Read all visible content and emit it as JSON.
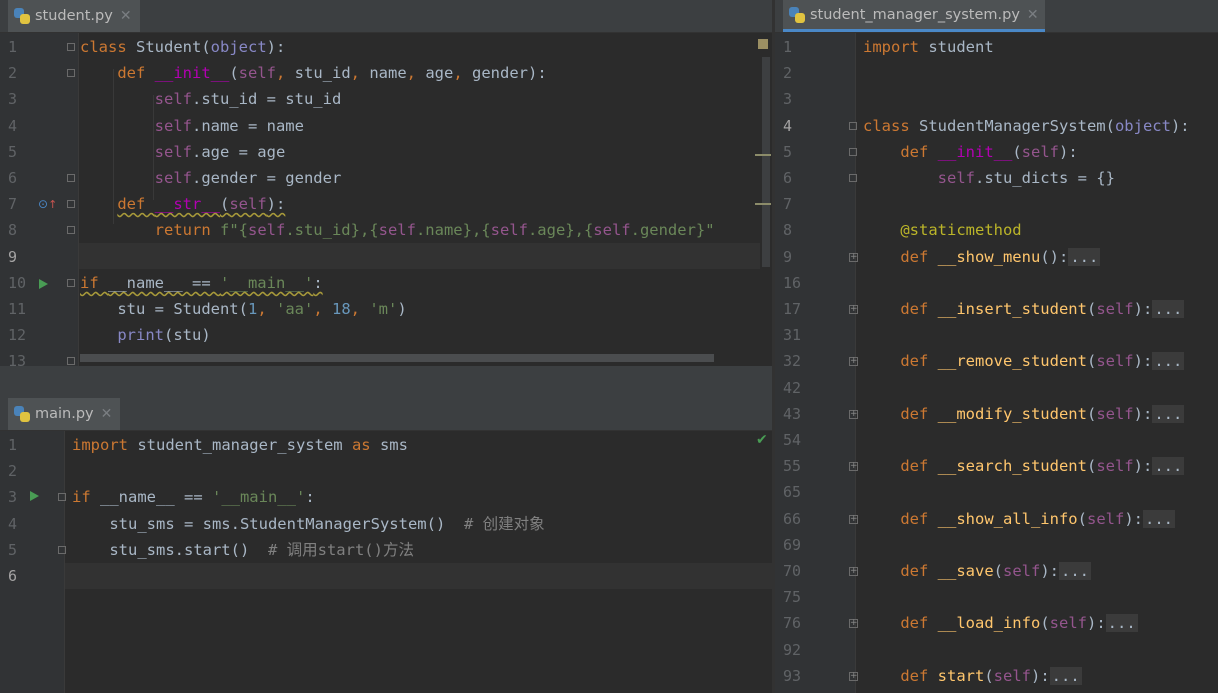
{
  "student": {
    "tab": "student.py",
    "lines": [
      {
        "n": "1",
        "s": [
          [
            "kw",
            "class "
          ],
          [
            "",
            "Student("
          ],
          [
            "ob",
            "object"
          ],
          [
            "",
            "):"
          ]
        ]
      },
      {
        "n": "2",
        "s": [
          [
            "",
            "    "
          ],
          [
            "kw",
            "def "
          ],
          [
            "mg",
            "__init__"
          ],
          [
            "",
            "("
          ],
          [
            "sf",
            "self"
          ],
          [
            "kw",
            ", "
          ],
          [
            "",
            "stu_id"
          ],
          [
            "kw",
            ", "
          ],
          [
            "",
            "name"
          ],
          [
            "kw",
            ", "
          ],
          [
            "",
            "age"
          ],
          [
            "kw",
            ", "
          ],
          [
            "",
            "gender):"
          ]
        ]
      },
      {
        "n": "3",
        "s": [
          [
            "",
            "        "
          ],
          [
            "sf",
            "self"
          ],
          [
            "",
            ".stu_id = stu_id"
          ]
        ]
      },
      {
        "n": "4",
        "s": [
          [
            "",
            "        "
          ],
          [
            "sf",
            "self"
          ],
          [
            "",
            ".name = name"
          ]
        ]
      },
      {
        "n": "5",
        "s": [
          [
            "",
            "        "
          ],
          [
            "sf",
            "self"
          ],
          [
            "",
            ".age = age"
          ]
        ]
      },
      {
        "n": "6",
        "s": [
          [
            "",
            "        "
          ],
          [
            "sf",
            "self"
          ],
          [
            "",
            ".gender = gender"
          ]
        ]
      },
      {
        "n": "7",
        "s": [
          [
            "",
            "    "
          ],
          [
            "kw",
            "def "
          ],
          [
            "mg",
            "__str__"
          ],
          [
            "",
            "("
          ],
          [
            "sf",
            "self"
          ],
          [
            "",
            "):"
          ]
        ]
      },
      {
        "n": "8",
        "s": [
          [
            "",
            "        "
          ],
          [
            "kw",
            "return "
          ],
          [
            "st",
            "f\"{"
          ],
          [
            "sf",
            "self"
          ],
          [
            "st",
            ".stu_id},{"
          ],
          [
            "sf",
            "self"
          ],
          [
            "st",
            ".name},{"
          ],
          [
            "sf",
            "self"
          ],
          [
            "st",
            ".age},{"
          ],
          [
            "sf",
            "self"
          ],
          [
            "st",
            ".gender}\""
          ]
        ]
      },
      {
        "n": "9",
        "s": []
      },
      {
        "n": "10",
        "s": [
          [
            "kw",
            "if "
          ],
          [
            "",
            "__name__ == "
          ],
          [
            "st",
            "'__main__'"
          ],
          [
            "",
            ":"
          ]
        ]
      },
      {
        "n": "11",
        "s": [
          [
            "",
            "    stu = Student("
          ],
          [
            "nm",
            "1"
          ],
          [
            "kw",
            ", "
          ],
          [
            "st",
            "'aa'"
          ],
          [
            "kw",
            ", "
          ],
          [
            "nm",
            "18"
          ],
          [
            "kw",
            ", "
          ],
          [
            "st",
            "'m'"
          ],
          [
            "",
            ")"
          ]
        ]
      },
      {
        "n": "12",
        "s": [
          [
            "",
            "    "
          ],
          [
            "ob",
            "print"
          ],
          [
            "",
            "(stu)"
          ]
        ]
      },
      {
        "n": "13",
        "s": []
      }
    ]
  },
  "main": {
    "tab": "main.py",
    "lines": [
      {
        "n": "1",
        "s": [
          [
            "kw",
            "import "
          ],
          [
            "",
            "student_manager_system "
          ],
          [
            "kw",
            "as "
          ],
          [
            "",
            "sms"
          ]
        ]
      },
      {
        "n": "2",
        "s": []
      },
      {
        "n": "3",
        "s": [
          [
            "kw",
            "if "
          ],
          [
            "",
            "__name__ == "
          ],
          [
            "st",
            "'__main__'"
          ],
          [
            "",
            ":"
          ]
        ]
      },
      {
        "n": "4",
        "s": [
          [
            "",
            "    stu_sms = sms.StudentManagerSystem()  "
          ],
          [
            "cm",
            "# 创建对象"
          ]
        ]
      },
      {
        "n": "5",
        "s": [
          [
            "",
            "    stu_sms.start()  "
          ],
          [
            "cm",
            "# 调用start()方法"
          ]
        ]
      },
      {
        "n": "6",
        "s": []
      }
    ]
  },
  "sms": {
    "tab": "student_manager_system.py",
    "lines": [
      {
        "n": "1",
        "s": [
          [
            "kw",
            "import "
          ],
          [
            "",
            "student"
          ]
        ]
      },
      {
        "n": "2",
        "s": []
      },
      {
        "n": "3",
        "s": []
      },
      {
        "n": "4",
        "s": [
          [
            "kw",
            "class "
          ],
          [
            "",
            "StudentManagerSystem("
          ],
          [
            "ob",
            "object"
          ],
          [
            "",
            "):"
          ]
        ]
      },
      {
        "n": "5",
        "s": [
          [
            "",
            "    "
          ],
          [
            "kw",
            "def "
          ],
          [
            "mg",
            "__init__"
          ],
          [
            "",
            "("
          ],
          [
            "sf",
            "self"
          ],
          [
            "",
            "):"
          ]
        ]
      },
      {
        "n": "6",
        "s": [
          [
            "",
            "        "
          ],
          [
            "sf",
            "self"
          ],
          [
            "",
            ".stu_dicts = {}"
          ]
        ]
      },
      {
        "n": "7",
        "s": []
      },
      {
        "n": "8",
        "s": [
          [
            "",
            "    "
          ],
          [
            "dec",
            "@staticmethod"
          ]
        ]
      },
      {
        "n": "9",
        "s": [
          [
            "",
            "    "
          ],
          [
            "kw",
            "def "
          ],
          [
            "fn",
            "__show_menu"
          ],
          [
            "",
            "():"
          ],
          [
            "c",
            "..."
          ]
        ]
      },
      {
        "n": "16",
        "s": []
      },
      {
        "n": "17",
        "s": [
          [
            "",
            "    "
          ],
          [
            "kw",
            "def "
          ],
          [
            "fn",
            "__insert_student"
          ],
          [
            "",
            "("
          ],
          [
            "sf",
            "self"
          ],
          [
            "",
            "):"
          ],
          [
            "c",
            "..."
          ]
        ]
      },
      {
        "n": "31",
        "s": []
      },
      {
        "n": "32",
        "s": [
          [
            "",
            "    "
          ],
          [
            "kw",
            "def "
          ],
          [
            "fn",
            "__remove_student"
          ],
          [
            "",
            "("
          ],
          [
            "sf",
            "self"
          ],
          [
            "",
            "):"
          ],
          [
            "c",
            "..."
          ]
        ]
      },
      {
        "n": "42",
        "s": []
      },
      {
        "n": "43",
        "s": [
          [
            "",
            "    "
          ],
          [
            "kw",
            "def "
          ],
          [
            "fn",
            "__modify_student"
          ],
          [
            "",
            "("
          ],
          [
            "sf",
            "self"
          ],
          [
            "",
            "):"
          ],
          [
            "c",
            "..."
          ]
        ]
      },
      {
        "n": "54",
        "s": []
      },
      {
        "n": "55",
        "s": [
          [
            "",
            "    "
          ],
          [
            "kw",
            "def "
          ],
          [
            "fn",
            "__search_student"
          ],
          [
            "",
            "("
          ],
          [
            "sf",
            "self"
          ],
          [
            "",
            "):"
          ],
          [
            "c",
            "..."
          ]
        ]
      },
      {
        "n": "65",
        "s": []
      },
      {
        "n": "66",
        "s": [
          [
            "",
            "    "
          ],
          [
            "kw",
            "def "
          ],
          [
            "fn",
            "__show_all_info"
          ],
          [
            "",
            "("
          ],
          [
            "sf",
            "self"
          ],
          [
            "",
            "):"
          ],
          [
            "c",
            "..."
          ]
        ]
      },
      {
        "n": "69",
        "s": []
      },
      {
        "n": "70",
        "s": [
          [
            "",
            "    "
          ],
          [
            "kw",
            "def "
          ],
          [
            "fn",
            "__save"
          ],
          [
            "",
            "("
          ],
          [
            "sf",
            "self"
          ],
          [
            "",
            "):"
          ],
          [
            "c",
            "..."
          ]
        ]
      },
      {
        "n": "75",
        "s": []
      },
      {
        "n": "76",
        "s": [
          [
            "",
            "    "
          ],
          [
            "kw",
            "def "
          ],
          [
            "fn",
            "__load_info"
          ],
          [
            "",
            "("
          ],
          [
            "sf",
            "self"
          ],
          [
            "",
            "):"
          ],
          [
            "c",
            "..."
          ]
        ]
      },
      {
        "n": "92",
        "s": []
      },
      {
        "n": "93",
        "s": [
          [
            "",
            "    "
          ],
          [
            "kw",
            "def "
          ],
          [
            "fn",
            "start"
          ],
          [
            "",
            "("
          ],
          [
            "sf",
            "self"
          ],
          [
            "",
            "):"
          ],
          [
            "c",
            "..."
          ]
        ]
      }
    ]
  }
}
